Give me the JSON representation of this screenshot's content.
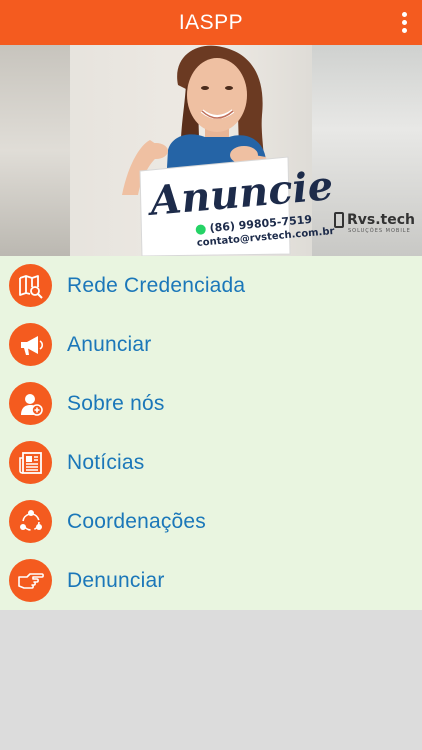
{
  "appbar": {
    "title": "IASPP",
    "menu_icon": "overflow-menu-icon"
  },
  "banner": {
    "headline": "Anuncie",
    "phone": "(86) 99805-7519",
    "email": "contato@rvstech.com.br",
    "brand": "Rvs.tech",
    "brand_tagline": "SOLUÇÕES MOBILE"
  },
  "menu": {
    "items": [
      {
        "label": "Rede Credenciada",
        "icon": "map-search-icon"
      },
      {
        "label": "Anunciar",
        "icon": "megaphone-icon"
      },
      {
        "label": "Sobre nós",
        "icon": "user-add-icon"
      },
      {
        "label": "Notícias",
        "icon": "newspaper-icon"
      },
      {
        "label": "Coordenações",
        "icon": "network-cycle-icon"
      },
      {
        "label": "Denunciar",
        "icon": "pointing-hand-icon"
      }
    ]
  },
  "colors": {
    "primary": "#f45b1f",
    "menu_bg": "#e9f5e0",
    "link": "#1b77b9",
    "page_bg": "#dcdcdc"
  }
}
